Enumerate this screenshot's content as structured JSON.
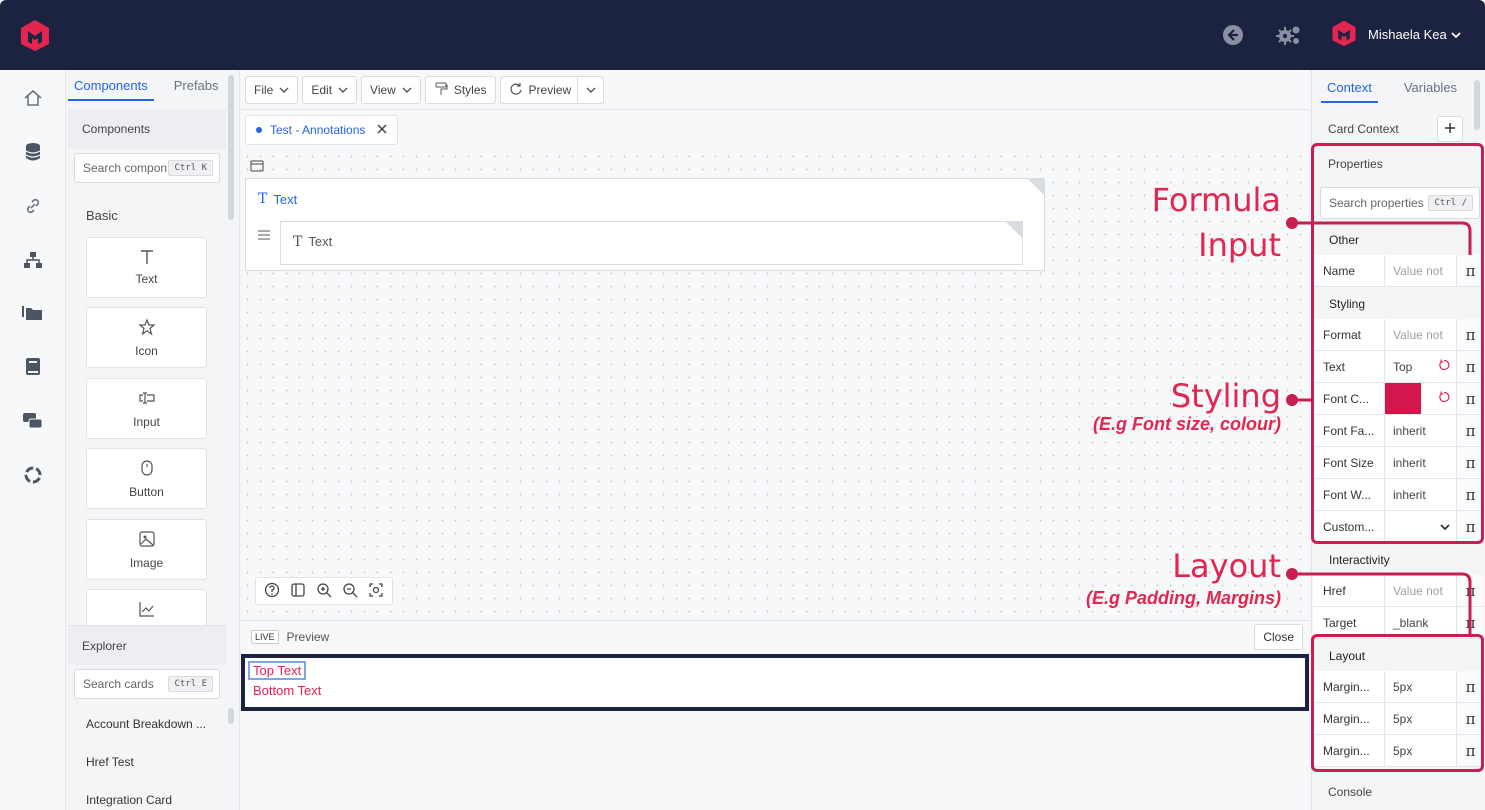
{
  "topbar": {
    "user_name": "Mishaela Kea",
    "brand_color": "#e2264f"
  },
  "left_panel": {
    "tabs": [
      {
        "label": "Components"
      },
      {
        "label": "Prefabs"
      }
    ],
    "section_title": "Components",
    "search_placeholder": "Search compon",
    "search_shortcut": "Ctrl K",
    "basic_label": "Basic",
    "components": [
      {
        "label": "Text"
      },
      {
        "label": "Icon"
      },
      {
        "label": "Input"
      },
      {
        "label": "Button"
      },
      {
        "label": "Image"
      }
    ],
    "explorer_title": "Explorer",
    "explorer_search_placeholder": "Search cards",
    "explorer_shortcut": "Ctrl E",
    "cards": [
      {
        "label": "Account Breakdown ..."
      },
      {
        "label": "Href Test"
      },
      {
        "label": "Integration Card"
      }
    ]
  },
  "toolbar": {
    "file": "File",
    "edit": "Edit",
    "view": "View",
    "styles": "Styles",
    "preview": "Preview"
  },
  "editor": {
    "tab_name": "Test - Annotations",
    "outer_text": "Text",
    "inner_text": "Text"
  },
  "preview": {
    "live_badge": "LIVE",
    "label": "Preview",
    "close": "Close",
    "top_text": "Top Text",
    "bottom_text": "Bottom Text"
  },
  "right_panel": {
    "tabs": [
      {
        "label": "Context"
      },
      {
        "label": "Variables"
      }
    ],
    "card_context": "Card Context",
    "properties_title": "Properties",
    "search_placeholder": "Search properties",
    "search_shortcut": "Ctrl /",
    "groups": {
      "other": "Other",
      "styling": "Styling",
      "interactivity": "Interactivity",
      "layout": "Layout"
    },
    "rows": {
      "name": {
        "label": "Name",
        "value": "Value not"
      },
      "format": {
        "label": "Format",
        "value": "Value not"
      },
      "text": {
        "label": "Text",
        "value": "Top"
      },
      "font_color": {
        "label": "Font C...",
        "value": "#d3174c"
      },
      "font_family": {
        "label": "Font Fa...",
        "value": "inherit"
      },
      "font_size": {
        "label": "Font Size",
        "value": "inherit"
      },
      "font_weight": {
        "label": "Font W...",
        "value": "inherit"
      },
      "custom": {
        "label": "Custom...",
        "value": ""
      },
      "href": {
        "label": "Href",
        "value": "Value not"
      },
      "target": {
        "label": "Target",
        "value": "_blank"
      },
      "margin1": {
        "label": "Margin...",
        "value": "5px"
      },
      "margin2": {
        "label": "Margin...",
        "value": "5px"
      },
      "margin3": {
        "label": "Margin...",
        "value": "5px"
      }
    },
    "console": "Console",
    "formula_symbol": "π"
  },
  "annotations": {
    "formula_line1": "Formula",
    "formula_line2": "Input",
    "styling_title": "Styling",
    "styling_sub": "(E.g Font size, colour)",
    "layout_title": "Layout",
    "layout_sub": "(E.g Padding, Margins)",
    "color": "#c81e50"
  }
}
